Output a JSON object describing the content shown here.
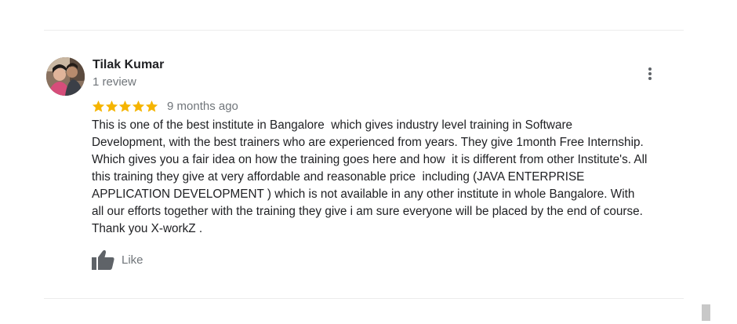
{
  "review": {
    "author_name": "Tilak Kumar",
    "author_review_count": "1 review",
    "rating": 5,
    "rating_max": 5,
    "time_ago": "9 months ago",
    "text_lines": [
      "This is one of the best institute in Bangalore  which gives industry level training in Software",
      "Development, with the best trainers who are experienced from years. They give 1month Free Internship.",
      "Which gives you a fair idea on how the training goes here and how  it is different from other Institute's. All",
      "this training they give at very affordable and reasonable price  including (JAVA ENTERPRISE",
      "APPLICATION DEVELOPMENT ) which is not available in any other institute in whole Bangalore. With",
      "all our efforts together with the training they give i am sure everyone will be placed by the end of course.",
      "Thank you X-workZ ."
    ],
    "like_label": "Like"
  },
  "icons": {
    "star": "star-icon",
    "more": "more-vert-icon",
    "like": "thumb-up-icon"
  },
  "colors": {
    "star": "#f5b400",
    "name": "#202124",
    "secondary_text": "#70757a",
    "icon": "#5f6368"
  }
}
